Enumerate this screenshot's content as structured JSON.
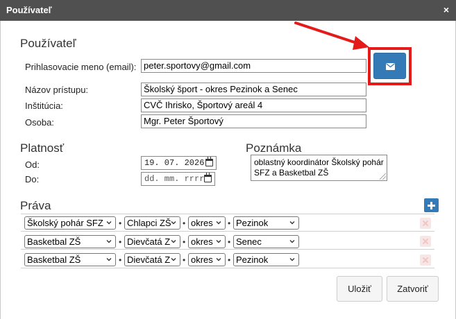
{
  "dialog": {
    "title": "Používateľ",
    "close_glyph": "×"
  },
  "user_section": {
    "heading": "Používateľ",
    "login_label": "Prihlasovacie meno (email):",
    "login_value": "peter.sportovy@gmail.com",
    "access_name_label": "Názov prístupu:",
    "access_name_value": "Školský šport - okres Pezinok a Senec",
    "institution_label": "Inštitúcia:",
    "institution_value": "CVČ Ihrisko, Športový areál 4",
    "person_label": "Osoba:",
    "person_value": "Mgr. Peter Športový",
    "send_email_icon": "envelope-icon"
  },
  "validity": {
    "heading": "Platnosť",
    "from_label": "Od:",
    "from_value": "19. 07. 2026",
    "to_label": "Do:",
    "to_placeholder": "dd. mm. rrrr"
  },
  "note": {
    "heading": "Poznámka",
    "value": "oblastný koordinátor Školský pohár SFZ a Basketbal ZŠ"
  },
  "rights": {
    "heading": "Práva",
    "separator": "•",
    "rows": [
      {
        "competition": "Školský pohár SFZ",
        "category": "Chlapci ZŠ",
        "level": "okres",
        "region": "Pezinok"
      },
      {
        "competition": "Basketbal ZŠ",
        "category": "Dievčatá Z",
        "level": "okres",
        "region": "Senec"
      },
      {
        "competition": "Basketbal ZŠ",
        "category": "Dievčatá Z",
        "level": "okres",
        "region": "Pezinok"
      }
    ]
  },
  "footer": {
    "save_label": "Uložiť",
    "close_label": "Zatvoriť"
  },
  "colors": {
    "titlebar": "#505050",
    "primary": "#337ab7",
    "highlight": "#e31b1b"
  }
}
